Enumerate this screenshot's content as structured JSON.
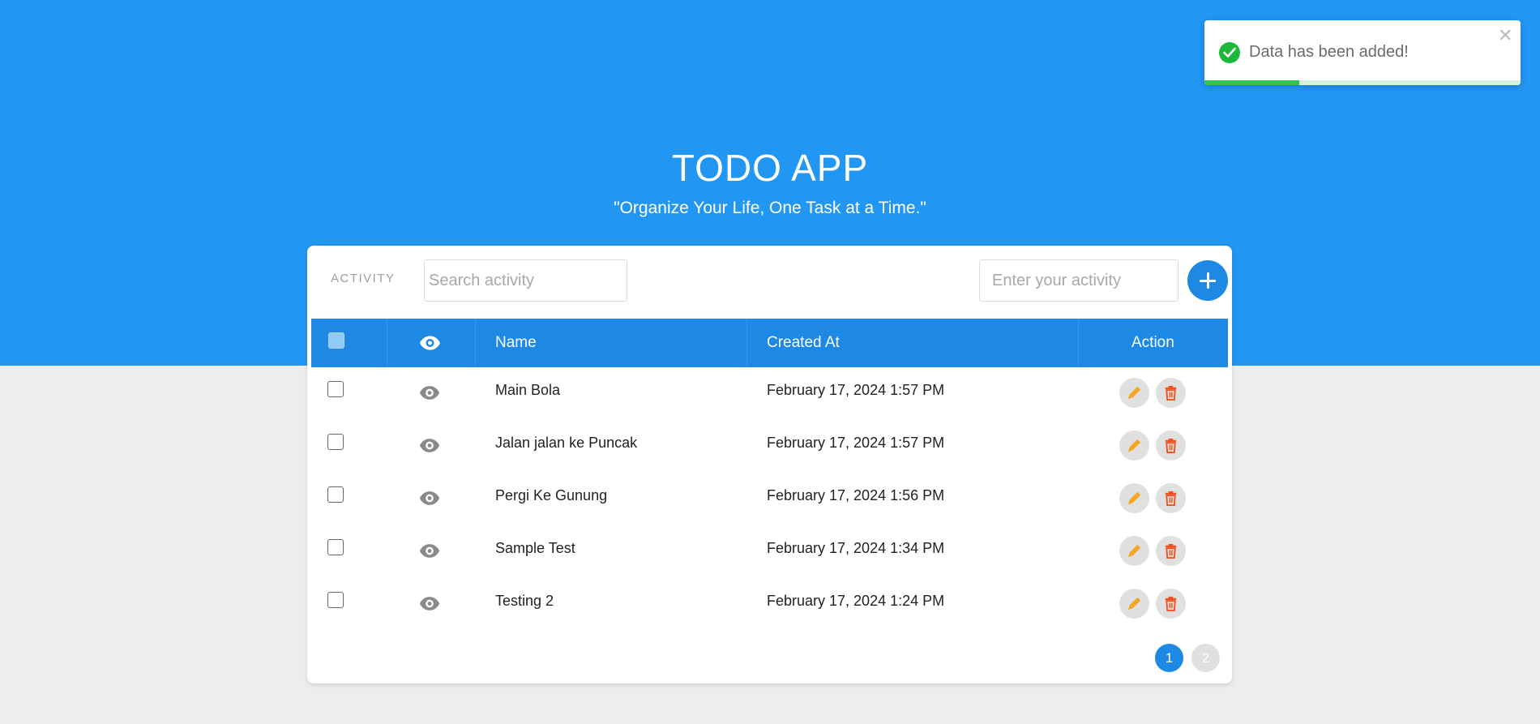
{
  "header": {
    "title": "TODO APP",
    "subtitle": "\"Organize Your Life, One Task at a Time.\""
  },
  "toolbar": {
    "activity_label": "ACTIVITY",
    "search_placeholder": "Search activity",
    "search_value": "",
    "activity_placeholder": "Enter your activity",
    "activity_value": "",
    "add_icon": "plus-icon"
  },
  "table": {
    "columns": {
      "select": "",
      "view": "eye-icon",
      "name": "Name",
      "created_at": "Created At",
      "action": "Action"
    },
    "rows": [
      {
        "checked": false,
        "name": "Main Bola",
        "created_at": "February 17, 2024 1:57 PM"
      },
      {
        "checked": false,
        "name": "Jalan jalan ke Puncak",
        "created_at": "February 17, 2024 1:57 PM"
      },
      {
        "checked": false,
        "name": "Pergi Ke Gunung",
        "created_at": "February 17, 2024 1:56 PM"
      },
      {
        "checked": false,
        "name": "Sample Test",
        "created_at": "February 17, 2024 1:34 PM"
      },
      {
        "checked": false,
        "name": "Testing 2",
        "created_at": "February 17, 2024 1:24 PM"
      }
    ]
  },
  "pagination": {
    "pages": [
      "1",
      "2"
    ],
    "current": "1"
  },
  "toast": {
    "message": "Data has been added!",
    "close_symbol": "✕",
    "progress": 0.3
  },
  "colors": {
    "primary": "#2196f3",
    "header_row": "#1e88e5",
    "edit_icon": "#f5a623",
    "delete_icon": "#f4511e",
    "success": "#1cb83a"
  }
}
